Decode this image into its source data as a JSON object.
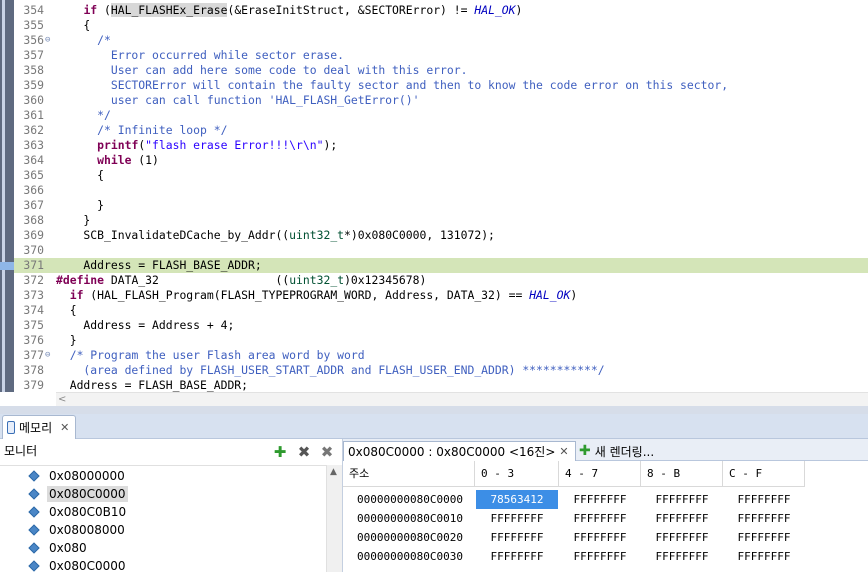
{
  "editor": {
    "lines": [
      {
        "n": "354",
        "fold": "",
        "hl": false,
        "code": [
          [
            "",
            "    "
          ],
          [
            "kw",
            "if"
          ],
          [
            "",
            " ("
          ],
          [
            "fnh",
            "HAL_FLASHEx_Erase"
          ],
          [
            "",
            "(&EraseInitStruct, &SECTORError) != "
          ],
          [
            "mc",
            "HAL_OK"
          ],
          [
            "",
            ")"
          ]
        ]
      },
      {
        "n": "355",
        "fold": "",
        "hl": false,
        "code": [
          [
            "",
            "    {"
          ]
        ]
      },
      {
        "n": "356",
        "fold": "⊖",
        "hl": false,
        "code": [
          [
            "",
            "      "
          ],
          [
            "cb",
            "/*"
          ]
        ]
      },
      {
        "n": "357",
        "fold": "",
        "hl": false,
        "code": [
          [
            "cb",
            "        Error occurred while sector erase."
          ]
        ]
      },
      {
        "n": "358",
        "fold": "",
        "hl": false,
        "code": [
          [
            "cb",
            "        User can add here some code to deal with this error."
          ]
        ]
      },
      {
        "n": "359",
        "fold": "",
        "hl": false,
        "code": [
          [
            "cb",
            "        SECTORError will contain the faulty sector and then to know the code error on this sector,"
          ]
        ]
      },
      {
        "n": "360",
        "fold": "",
        "hl": false,
        "code": [
          [
            "cb",
            "        user can call function 'HAL_FLASH_GetError()'"
          ]
        ]
      },
      {
        "n": "361",
        "fold": "",
        "hl": false,
        "code": [
          [
            "cb",
            "      */"
          ]
        ]
      },
      {
        "n": "362",
        "fold": "",
        "hl": false,
        "code": [
          [
            "",
            "      "
          ],
          [
            "cb",
            "/* Infinite loop */"
          ]
        ]
      },
      {
        "n": "363",
        "fold": "",
        "hl": false,
        "code": [
          [
            "",
            "      "
          ],
          [
            "kw",
            "printf"
          ],
          [
            "",
            "("
          ],
          [
            "st",
            "\"flash erase Error!!!\\r\\n\""
          ],
          [
            "",
            ");"
          ]
        ]
      },
      {
        "n": "364",
        "fold": "",
        "hl": false,
        "code": [
          [
            "",
            "      "
          ],
          [
            "kw",
            "while"
          ],
          [
            "",
            " (1)"
          ]
        ]
      },
      {
        "n": "365",
        "fold": "",
        "hl": false,
        "code": [
          [
            "",
            "      {"
          ]
        ]
      },
      {
        "n": "366",
        "fold": "",
        "hl": false,
        "code": [
          [
            "",
            ""
          ]
        ]
      },
      {
        "n": "367",
        "fold": "",
        "hl": false,
        "code": [
          [
            "",
            "      }"
          ]
        ]
      },
      {
        "n": "368",
        "fold": "",
        "hl": false,
        "code": [
          [
            "",
            "    }"
          ]
        ]
      },
      {
        "n": "369",
        "fold": "",
        "hl": false,
        "code": [
          [
            "",
            "    SCB_InvalidateDCache_by_Addr(("
          ],
          [
            "ty",
            "uint32_t"
          ],
          [
            "",
            "*)0x080C0000, 131072);"
          ]
        ]
      },
      {
        "n": "370",
        "fold": "",
        "hl": false,
        "code": [
          [
            "",
            ""
          ]
        ]
      },
      {
        "n": "371",
        "fold": "",
        "hl": true,
        "code": [
          [
            "",
            "    Address = FLASH_BASE_ADDR;"
          ]
        ]
      },
      {
        "n": "372",
        "fold": "",
        "hl": false,
        "code": [
          [
            "pp",
            "#define"
          ],
          [
            "",
            " DATA_32                 (("
          ],
          [
            "ty",
            "uint32_t"
          ],
          [
            "",
            ")0x12345678)"
          ]
        ]
      },
      {
        "n": "373",
        "fold": "",
        "hl": false,
        "code": [
          [
            "",
            "  "
          ],
          [
            "kw",
            "if"
          ],
          [
            "",
            " (HAL_FLASH_Program(FLASH_TYPEPROGRAM_WORD, Address, DATA_32) == "
          ],
          [
            "mc",
            "HAL_OK"
          ],
          [
            "",
            ")"
          ]
        ]
      },
      {
        "n": "374",
        "fold": "",
        "hl": false,
        "code": [
          [
            "",
            "  {"
          ]
        ]
      },
      {
        "n": "375",
        "fold": "",
        "hl": false,
        "code": [
          [
            "",
            "    Address = Address + 4;"
          ]
        ]
      },
      {
        "n": "376",
        "fold": "",
        "hl": false,
        "code": [
          [
            "",
            "  }"
          ]
        ]
      },
      {
        "n": "377",
        "fold": "⊖",
        "hl": false,
        "code": [
          [
            "",
            "  "
          ],
          [
            "cb",
            "/* Program the user Flash area word by word"
          ]
        ]
      },
      {
        "n": "378",
        "fold": "",
        "hl": false,
        "code": [
          [
            "cb",
            "    (area defined by FLASH_USER_START_ADDR and FLASH_USER_END_ADDR) ***********/"
          ]
        ]
      },
      {
        "n": "379",
        "fold": "",
        "hl": false,
        "code": [
          [
            "",
            "  Address = FLASH_BASE_ADDR;"
          ]
        ]
      }
    ]
  },
  "memory_view": {
    "tab_label": "메모리",
    "monitor_title": "모니터",
    "monitors": [
      "0x08000000",
      "0x080C0000",
      "0x080C0B10",
      "0x08008000",
      "0x080",
      "0x080C0000"
    ],
    "selected_monitor": 1,
    "render_tab": "0x080C0000 : 0x80C0000 <16진>",
    "new_render_tab": "새 렌더링...",
    "table": {
      "headers": [
        "주소",
        "0 - 3",
        "4 - 7",
        "8 - B",
        "C - F"
      ],
      "rows": [
        [
          "00000000080C0000",
          "78563412",
          "FFFFFFFF",
          "FFFFFFFF",
          "FFFFFFFF"
        ],
        [
          "00000000080C0010",
          "FFFFFFFF",
          "FFFFFFFF",
          "FFFFFFFF",
          "FFFFFFFF"
        ],
        [
          "00000000080C0020",
          "FFFFFFFF",
          "FFFFFFFF",
          "FFFFFFFF",
          "FFFFFFFF"
        ],
        [
          "00000000080C0030",
          "FFFFFFFF",
          "FFFFFFFF",
          "FFFFFFFF",
          "FFFFFFFF"
        ]
      ]
    }
  },
  "colors": {
    "highlight_line": "#d4e5b8",
    "selected_cell": "#3c8ee6",
    "tabbar": "#d7e1f0"
  }
}
